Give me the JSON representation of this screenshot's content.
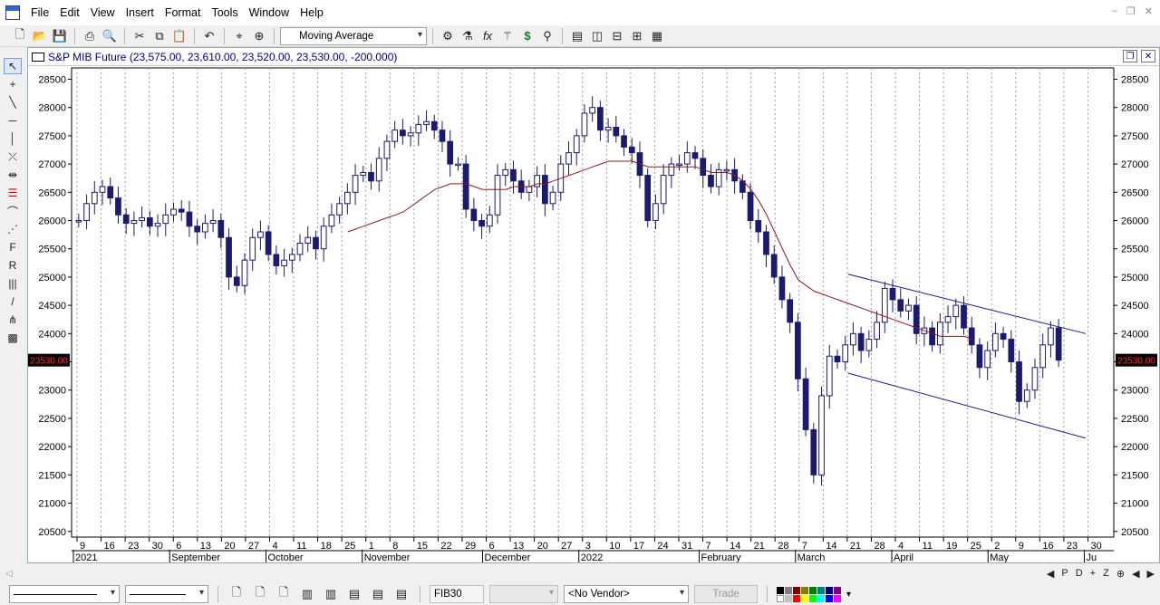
{
  "menu": {
    "items": [
      "File",
      "Edit",
      "View",
      "Insert",
      "Format",
      "Tools",
      "Window",
      "Help"
    ]
  },
  "toolbar": {
    "indicator_select": "Moving Average"
  },
  "chart": {
    "title": "S&P MIB Future (23,575.00, 23,610.00, 23,520.00, 23,530.00, -200.000)",
    "last_price_label": "23530.00",
    "accent_color": "#1a1a6e",
    "ma_color": "#8b1a1a",
    "last_price_bg": "#000000",
    "last_price_fg": "#ff3030"
  },
  "chart_data": {
    "type": "line",
    "title": "S&P MIB Future (23,575.00, 23,610.00, 23,520.00, 23,530.00, -200.000)",
    "yticks": [
      28500,
      28000,
      27500,
      27000,
      26500,
      26000,
      25500,
      25000,
      24500,
      24000,
      23500,
      23000,
      22500,
      22000,
      21500,
      21000,
      20500
    ],
    "ylim": [
      20400,
      28700
    ],
    "day_ticks": [
      "9",
      "16",
      "23",
      "30",
      "6",
      "13",
      "20",
      "27",
      "4",
      "11",
      "18",
      "25",
      "1",
      "8",
      "15",
      "22",
      "29",
      "6",
      "13",
      "20",
      "27",
      "3",
      "10",
      "17",
      "24",
      "31",
      "7",
      "14",
      "21",
      "28",
      "7",
      "14",
      "21",
      "28",
      "4",
      "11",
      "19",
      "25",
      "2",
      "9",
      "16",
      "23",
      "30"
    ],
    "month_labels": [
      "2021",
      "September",
      "October",
      "November",
      "December",
      "2022",
      "February",
      "March",
      "April",
      "May",
      "Ju"
    ],
    "series": [
      {
        "name": "S&P MIB Future",
        "values": [
          26000,
          26300,
          26500,
          26600,
          26400,
          26100,
          25950,
          26000,
          26050,
          25900,
          25950,
          26100,
          26200,
          26150,
          25900,
          25800,
          25950,
          26000,
          25700,
          25000,
          24850,
          25300,
          25700,
          25800,
          25400,
          25200,
          25300,
          25400,
          25600,
          25700,
          25500,
          25900,
          26100,
          26300,
          26500,
          26800,
          26850,
          26700,
          27100,
          27400,
          27600,
          27500,
          27550,
          27700,
          27750,
          27600,
          27400,
          27000,
          27000,
          26200,
          26000,
          25900,
          26100,
          26800,
          26900,
          26700,
          26500,
          26600,
          26800,
          26300,
          26500,
          27000,
          27200,
          27500,
          27900,
          28000,
          27600,
          27650,
          27500,
          27300,
          27200,
          26800,
          26000,
          26300,
          26800,
          27000,
          27000,
          27200,
          27100,
          26800,
          26600,
          26900,
          26900,
          26700,
          26500,
          26000,
          25800,
          25400,
          25000,
          24600,
          24200,
          23200,
          22300,
          21500,
          22900,
          23600,
          23500,
          23800,
          24000,
          23700,
          23900,
          24200,
          24800,
          24600,
          24400,
          24500,
          24000,
          24100,
          23800,
          24200,
          24300,
          24500,
          24100,
          23800,
          23400,
          23700,
          24000,
          23900,
          23500,
          22800,
          23000,
          23400,
          23800,
          24100,
          23530
        ]
      },
      {
        "name": "Moving Average",
        "values": [
          null,
          null,
          null,
          null,
          null,
          null,
          null,
          null,
          null,
          null,
          null,
          null,
          null,
          null,
          null,
          null,
          null,
          null,
          null,
          null,
          null,
          null,
          null,
          null,
          null,
          null,
          null,
          null,
          null,
          null,
          null,
          null,
          null,
          null,
          25800,
          25850,
          25900,
          25950,
          26000,
          26050,
          26100,
          26150,
          26250,
          26350,
          26450,
          26550,
          26600,
          26650,
          26650,
          26650,
          26600,
          26550,
          26550,
          26550,
          26550,
          26600,
          26600,
          26600,
          26650,
          26650,
          26700,
          26750,
          26800,
          26850,
          26900,
          26950,
          27000,
          27050,
          27050,
          27050,
          27050,
          27000,
          26950,
          26950,
          26950,
          26950,
          26950,
          26950,
          26950,
          26900,
          26850,
          26850,
          26850,
          26800,
          26700,
          26550,
          26350,
          26100,
          25800,
          25500,
          25200,
          24950,
          24850,
          24750,
          24700,
          24650,
          24600,
          24550,
          24500,
          24450,
          24400,
          24350,
          24300,
          24250,
          24200,
          24150,
          24100,
          24050,
          24000,
          23950,
          23950,
          23950,
          23950,
          23900
        ]
      }
    ],
    "trendlines": [
      {
        "from": [
          0.745,
          25050
        ],
        "to": [
          0.973,
          24000
        ]
      },
      {
        "from": [
          0.745,
          23300
        ],
        "to": [
          0.973,
          22150
        ]
      }
    ]
  },
  "status": {
    "right_icons": [
      "P",
      "D",
      "+",
      "Z",
      "⊕"
    ]
  },
  "bottom": {
    "symbol_field": "FIB30",
    "vendor_select": "<No Vendor>",
    "trade_button": "Trade"
  }
}
